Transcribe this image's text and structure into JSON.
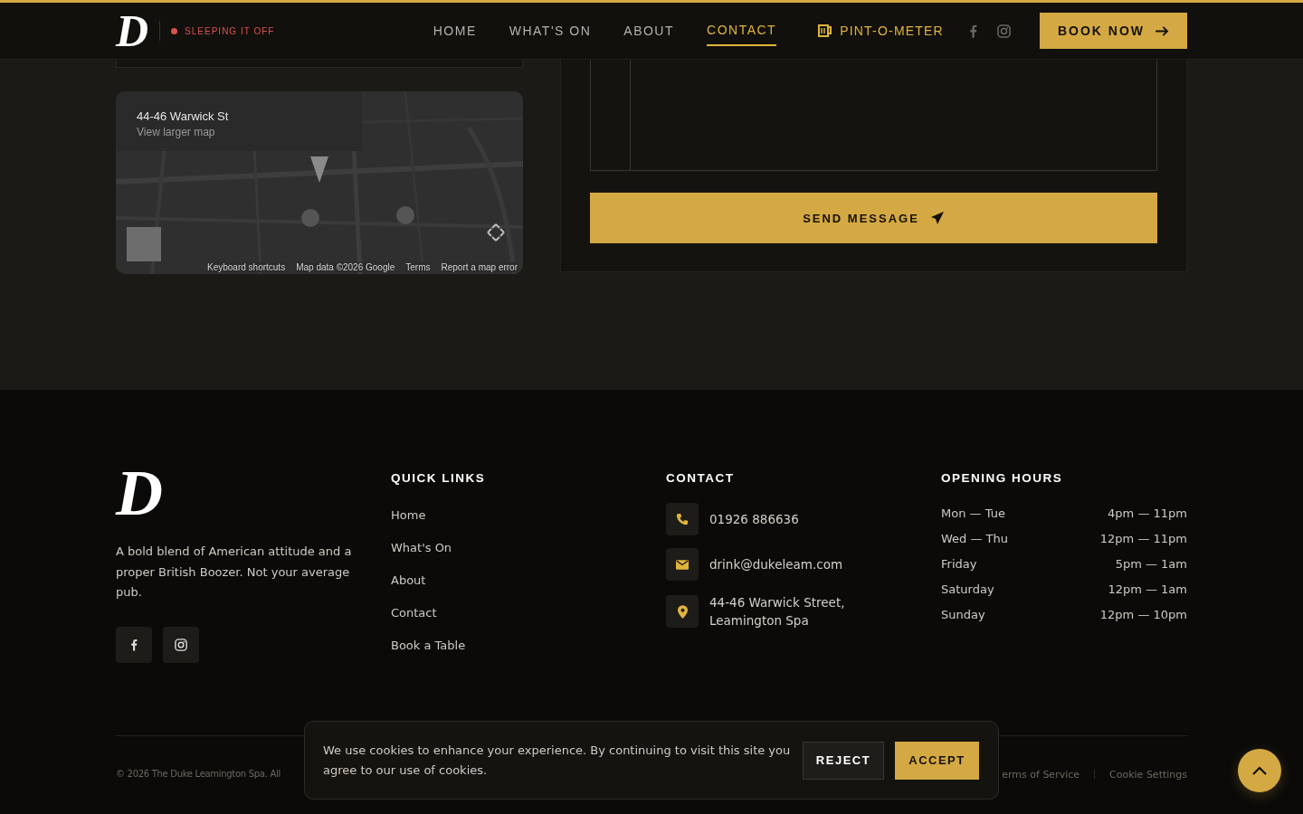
{
  "header": {
    "logo": "D",
    "status": {
      "label": "SLEEPING IT OFF",
      "color": "#d9534f"
    },
    "nav": [
      {
        "label": "HOME",
        "selected": false
      },
      {
        "label": "WHAT'S ON",
        "selected": false
      },
      {
        "label": "ABOUT",
        "selected": false
      },
      {
        "label": "CONTACT",
        "selected": true
      }
    ],
    "pint_meter": "PINT-O-METER",
    "book_button": "BOOK NOW"
  },
  "map": {
    "kind": "picture",
    "place_title": "44-46 Warwick St",
    "place_link": "View larger map",
    "attribution": [
      "Keyboard shortcuts",
      "Map data ©2026 Google",
      "Terms",
      "Report a map error"
    ]
  },
  "form": {
    "send_button": "SEND MESSAGE"
  },
  "footer": {
    "logo": "D",
    "description": "A bold blend of American attitude and a proper British Boozer. Not your average pub.",
    "quick_links": {
      "heading": "QUICK LINKS",
      "items": [
        "Home",
        "What's On",
        "About",
        "Contact",
        "Book a Table"
      ]
    },
    "contact": {
      "heading": "CONTACT",
      "items": [
        {
          "kind": "phone",
          "text": "01926 886636"
        },
        {
          "kind": "email",
          "text": "drink@dukeleam.com"
        },
        {
          "kind": "location",
          "text": "44-46 Warwick Street, Leamington Spa"
        }
      ]
    },
    "hours": {
      "heading": "OPENING HOURS",
      "rows": [
        {
          "days": "Mon — Tue",
          "time": "4pm — 11pm"
        },
        {
          "days": "Wed — Thu",
          "time": "12pm — 11pm"
        },
        {
          "days": "Friday",
          "time": "5pm — 1am"
        },
        {
          "days": "Saturday",
          "time": "12pm — 1am"
        },
        {
          "days": "Sunday",
          "time": "12pm — 10pm"
        }
      ]
    },
    "copyright": "© 2026 The Duke Leamington Spa. All",
    "legal_links": [
      "erms of Service",
      "Cookie Settings"
    ]
  },
  "cookie_banner": {
    "message": "We use cookies to enhance your experience. By continuing to visit this site you agree to our use of cookies.",
    "reject": "REJECT",
    "accept": "ACCEPT"
  }
}
